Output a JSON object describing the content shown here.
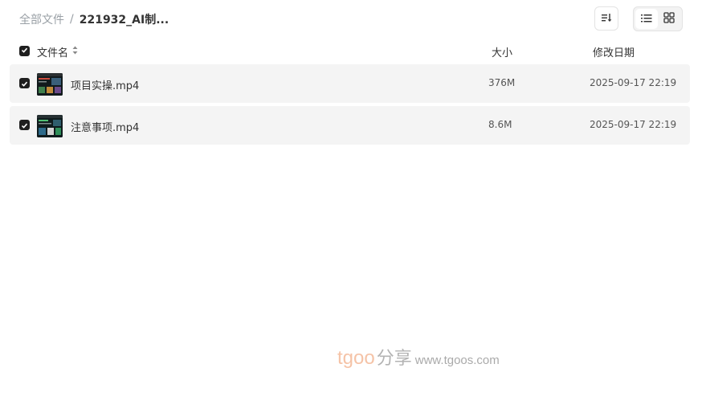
{
  "breadcrumb": {
    "root": "全部文件",
    "separator": "/",
    "current": "221932_AI制..."
  },
  "toolbar": {
    "sort_icon": "sort-list-icon",
    "view_list_icon": "list-view-icon",
    "view_grid_icon": "grid-view-icon",
    "active_view": "list"
  },
  "table": {
    "header": {
      "name": "文件名",
      "size": "大小",
      "date": "修改日期"
    },
    "rows": [
      {
        "name": "项目实操.mp4",
        "size": "376M",
        "date": "2025-09-17 22:19",
        "checked": true
      },
      {
        "name": "注意事项.mp4",
        "size": "8.6M",
        "date": "2025-09-17 22:19",
        "checked": true
      }
    ]
  },
  "watermark": {
    "brand": "tgoo",
    "cn": "分享",
    "url": "www.tgoos.com"
  },
  "colors": {
    "row_bg": "#f4f4f4",
    "checkbox": "#1f1f1f",
    "watermark_brand": "#f2b08a"
  }
}
